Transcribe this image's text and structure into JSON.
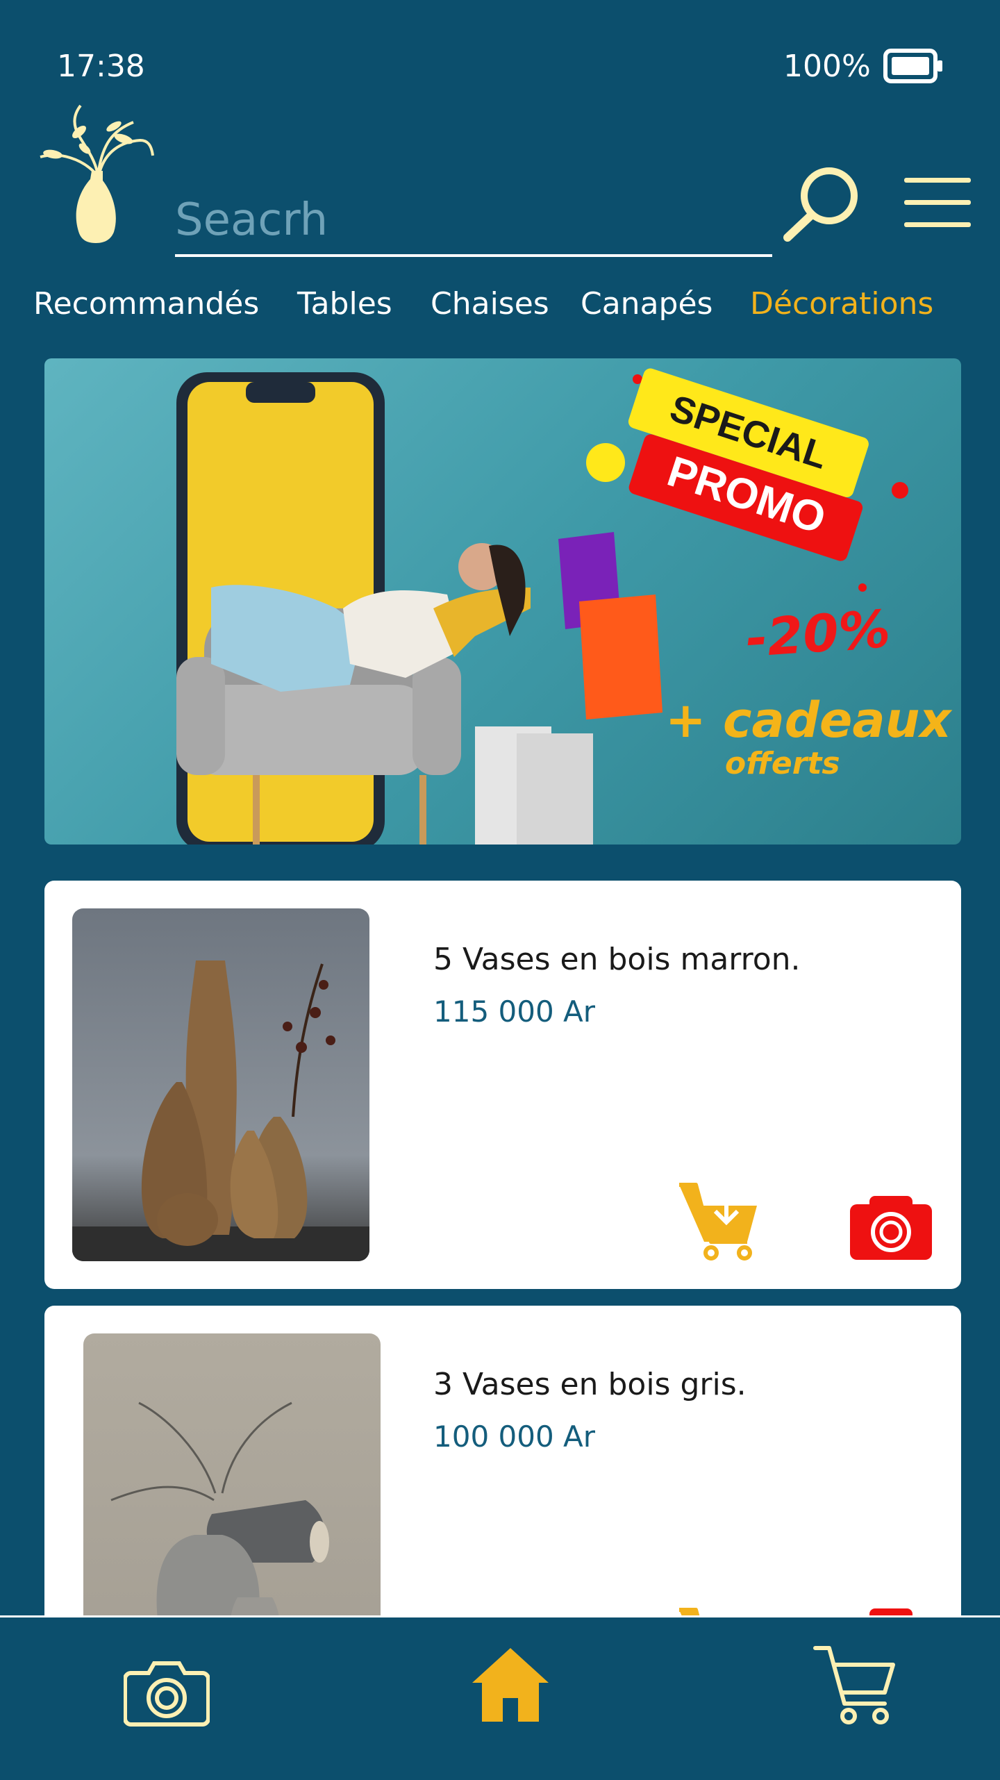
{
  "status": {
    "time": "17:38",
    "battery": "100%"
  },
  "search": {
    "placeholder": "Seacrh"
  },
  "tabs": [
    {
      "label": "Recommandés",
      "active": false
    },
    {
      "label": "Tables",
      "active": false
    },
    {
      "label": "Chaises",
      "active": false
    },
    {
      "label": "Canapés",
      "active": false
    },
    {
      "label": "Décorations",
      "active": true
    }
  ],
  "banner": {
    "badge_top": "SPECIAL",
    "badge_bottom": "PROMO",
    "discount": "-20%",
    "gift_line": "+ cadeaux",
    "gift_sub": "offerts"
  },
  "products": [
    {
      "name": "5 Vases en bois marron.",
      "price": "115 000 Ar"
    },
    {
      "name": "3 Vases en bois gris.",
      "price": "100 000 Ar"
    }
  ],
  "bottom_nav": [
    {
      "icon": "camera-icon"
    },
    {
      "icon": "home-icon",
      "active": true
    },
    {
      "icon": "cart-icon"
    }
  ],
  "colors": {
    "background": "#0c4f6d",
    "accent": "#f2b21c",
    "price": "#145d7c",
    "camera_red": "#ee1111",
    "icon_cream": "#fdf0b3"
  }
}
